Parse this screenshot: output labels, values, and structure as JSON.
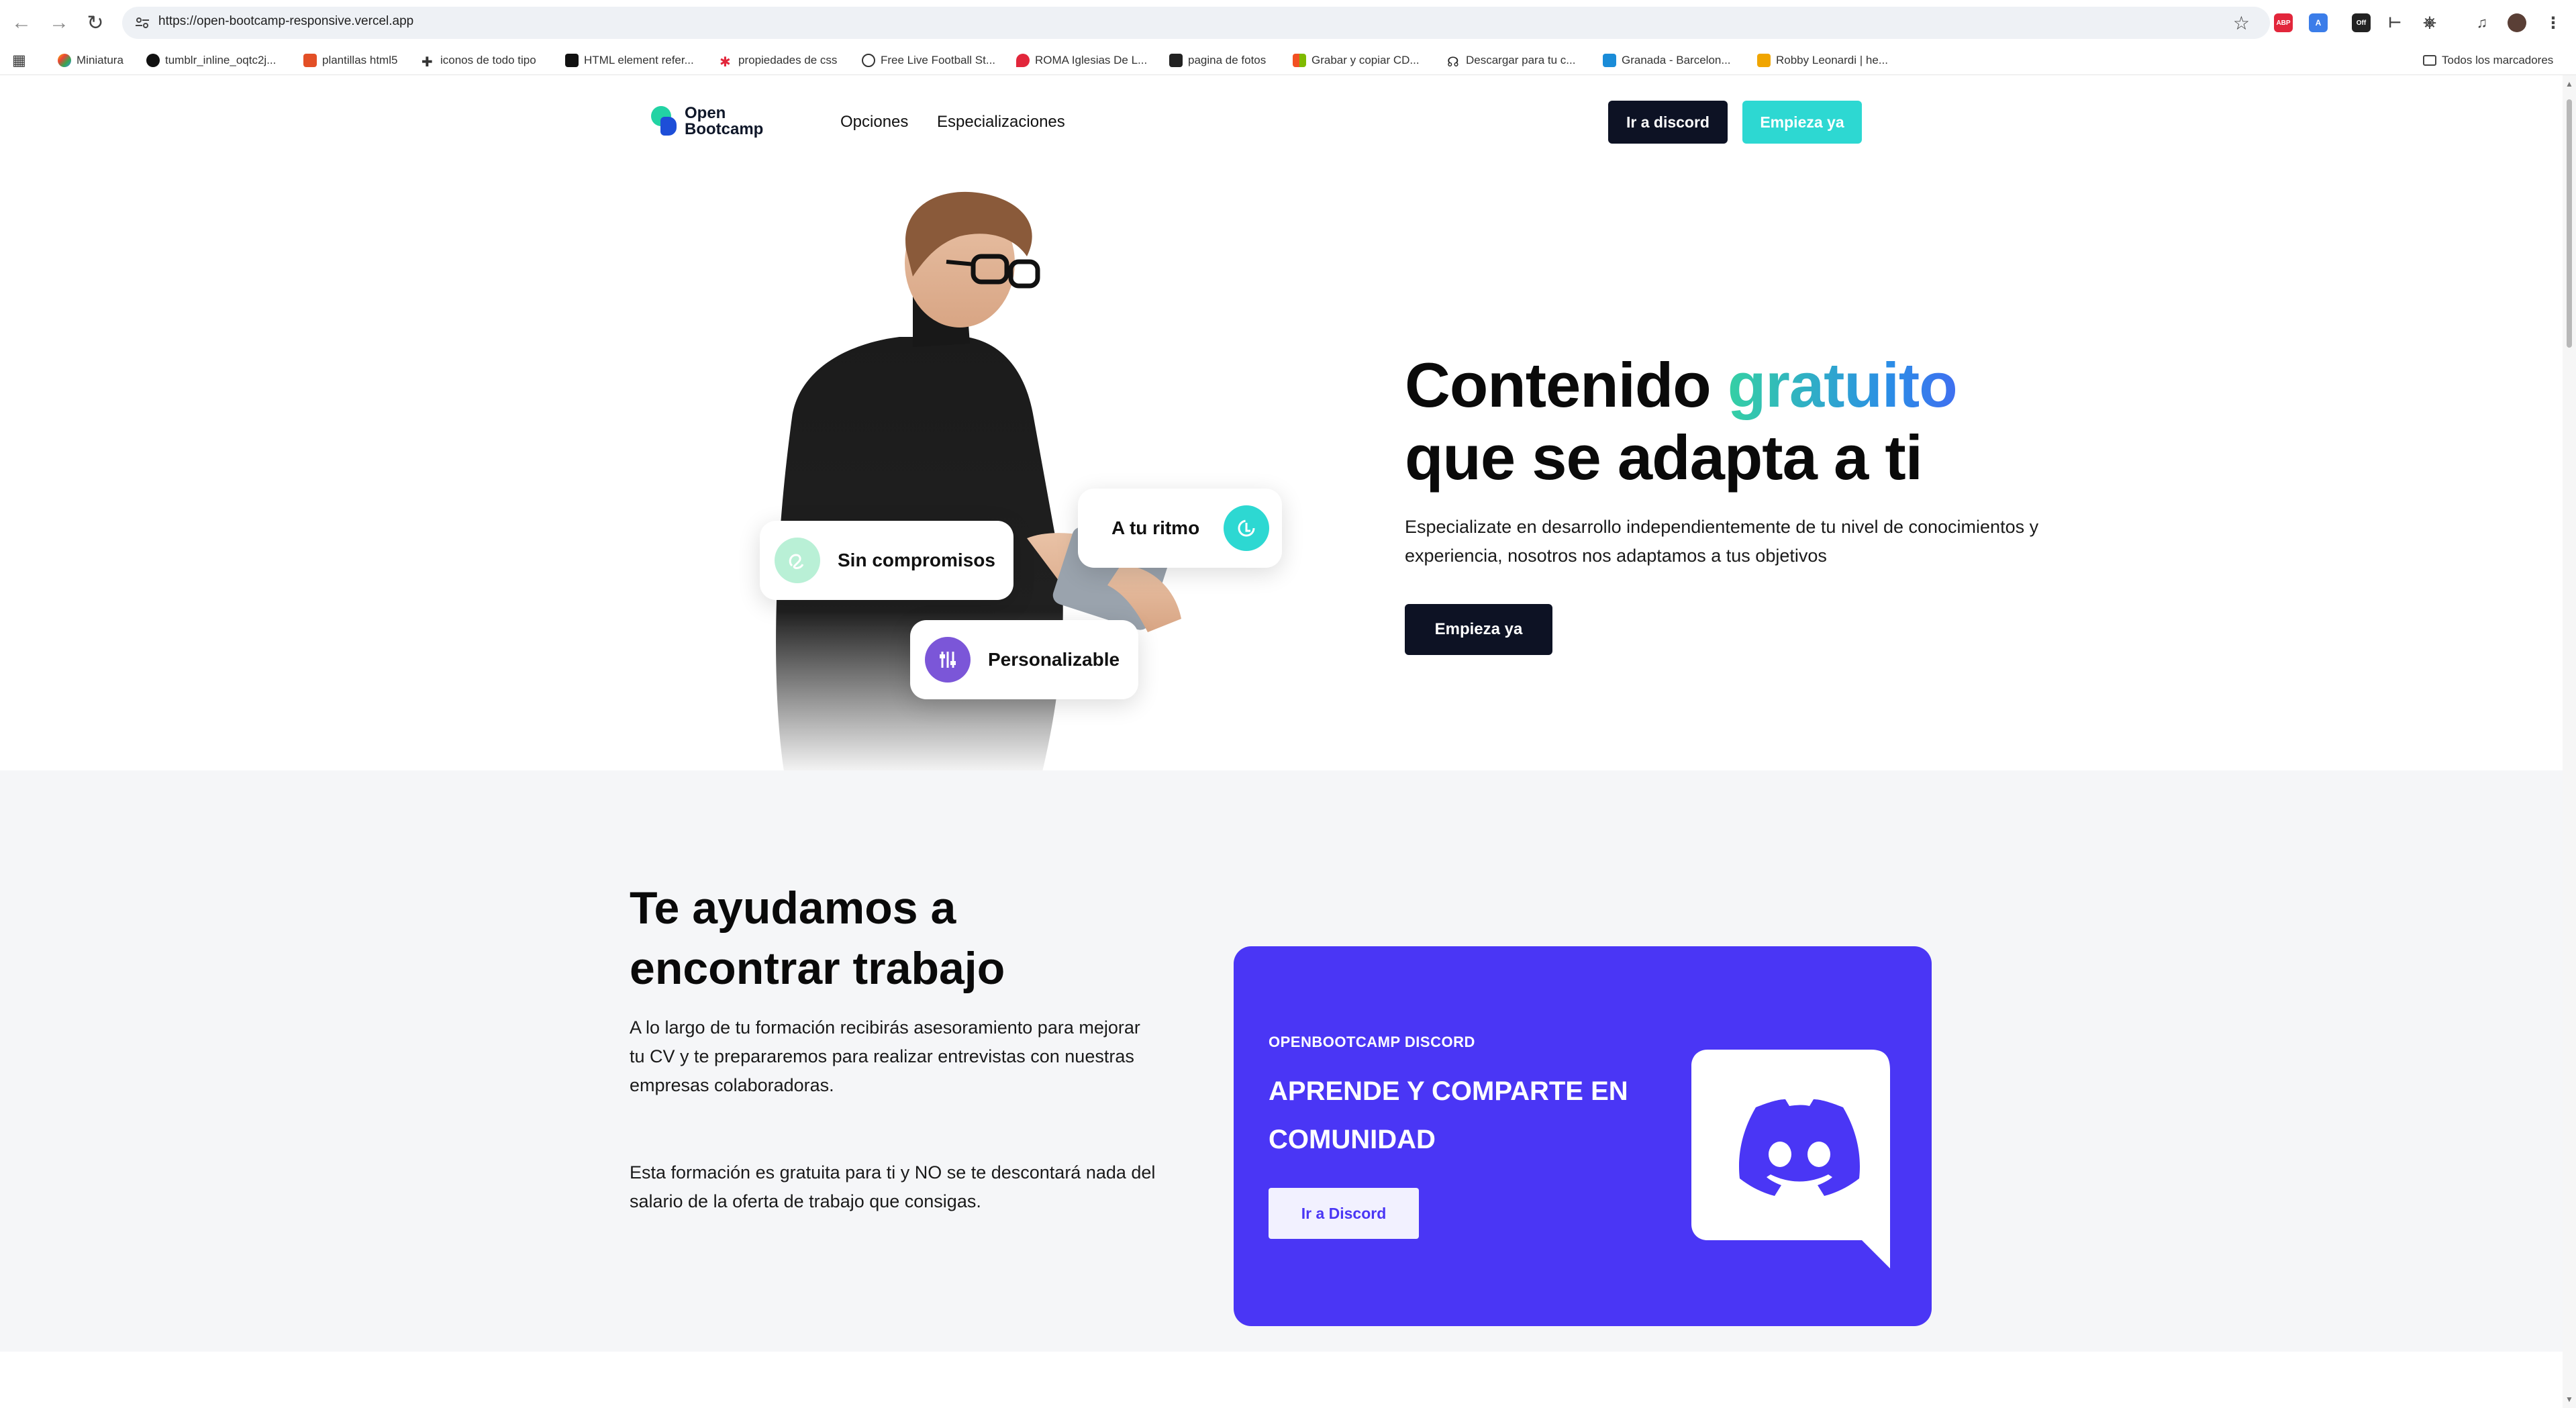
{
  "browser": {
    "url": "https://open-bootcamp-responsive.vercel.app",
    "bookmarks": [
      "Miniatura",
      "tumblr_inline_oqtc2j...",
      "plantillas html5",
      "iconos de todo tipo",
      "HTML element refer...",
      "propiedades de css",
      "Free Live Football St...",
      "ROMA Iglesias De L...",
      "pagina de fotos",
      "Grabar y copiar CD...",
      "Descargar para tu c...",
      "Granada - Barcelon...",
      "Robby Leonardi | he..."
    ],
    "all_bookmarks": "Todos los marcadores"
  },
  "header": {
    "logo_line1": "Open",
    "logo_line2": "Bootcamp",
    "nav": [
      "Opciones",
      "Especializaciones"
    ],
    "discord_button": "Ir a discord",
    "start_button": "Empieza ya"
  },
  "hero": {
    "title_part1": "Contenido",
    "title_highlight": "gratuito",
    "title_line2": "que se adapta a ti",
    "description": "Especializate en desarrollo independientemente de tu nivel de conocimientos y experiencia, nosotros nos adaptamos a tus objetivos",
    "cta": "Empieza ya",
    "chips": {
      "sin_compromisos": "Sin compromisos",
      "a_tu_ritmo": "A tu ritmo",
      "personalizable": "Personalizable"
    }
  },
  "jobs": {
    "title_line1": "Te ayudamos a",
    "title_line2": "encontrar trabajo",
    "paragraph1": "A lo largo de tu formación recibirás asesoramiento para mejorar tu CV y te prepararemos para realizar entrevistas con nuestras empresas colaboradoras.",
    "paragraph2": "Esta formación es gratuita para ti y NO se te descontará nada del salario de la oferta de trabajo que consigas."
  },
  "discord_card": {
    "eyebrow": "OPENBOOTCAMP DISCORD",
    "title": "APRENDE Y COMPARTE EN COMUNIDAD",
    "button": "Ir a Discord"
  },
  "colors": {
    "dark": "#0d1224",
    "teal": "#2dd8d2",
    "discord": "#4a36f5",
    "gradient_start": "#35d0a4",
    "gradient_end": "#3f6ff0"
  }
}
